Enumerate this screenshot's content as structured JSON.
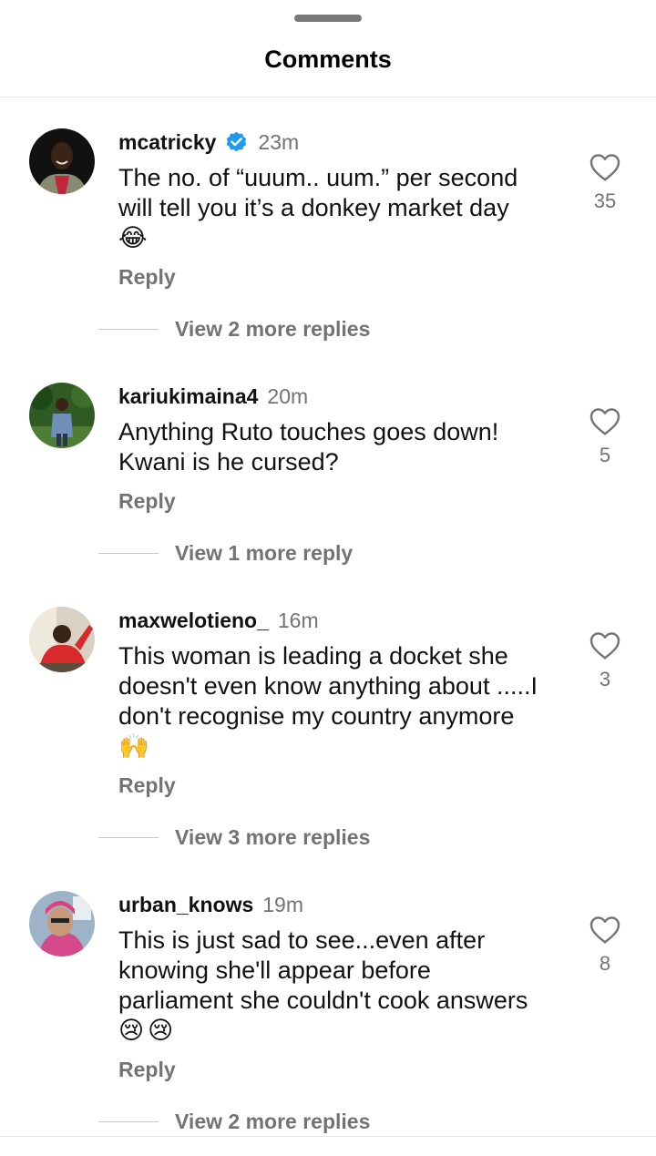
{
  "sheet": {
    "title": "Comments"
  },
  "comments": [
    {
      "username": "mcatricky",
      "verified": true,
      "time": "23m",
      "text_lines": [
        "The no. of “uuum.. uum.” per second",
        "will tell you it’s a donkey market day"
      ],
      "emoji": [
        "😂"
      ],
      "reply_label": "Reply",
      "more_replies": "View 2 more replies",
      "likes": "35"
    },
    {
      "username": "kariukimaina4",
      "verified": false,
      "time": "20m",
      "text_lines": [
        "Anything Ruto touches goes down!",
        "Kwani is he cursed?"
      ],
      "emoji": [],
      "reply_label": "Reply",
      "more_replies": "View 1 more reply",
      "likes": "5"
    },
    {
      "username": "maxwelotieno_",
      "verified": false,
      "time": "16m",
      "text_lines": [
        "This woman is leading a docket she",
        "doesn't even know anything about .....I",
        "don't recognise my country anymore"
      ],
      "emoji": [
        "🙌"
      ],
      "reply_label": "Reply",
      "more_replies": "View 3 more replies",
      "likes": "3"
    },
    {
      "username": "urban_knows",
      "verified": false,
      "time": "19m",
      "text_lines": [
        "This is just sad to see...even after",
        "knowing she'll appear before",
        "parliament she couldn't cook answers"
      ],
      "emoji": [
        "😢",
        "😢"
      ],
      "reply_label": "Reply",
      "more_replies": "View 2 more replies",
      "likes": "8"
    }
  ],
  "icons": {
    "heart": "heart-outline-icon",
    "verified": "verified-badge-icon"
  },
  "colors": {
    "verified_blue": "#1d9bf0",
    "muted_text": "#737373"
  }
}
